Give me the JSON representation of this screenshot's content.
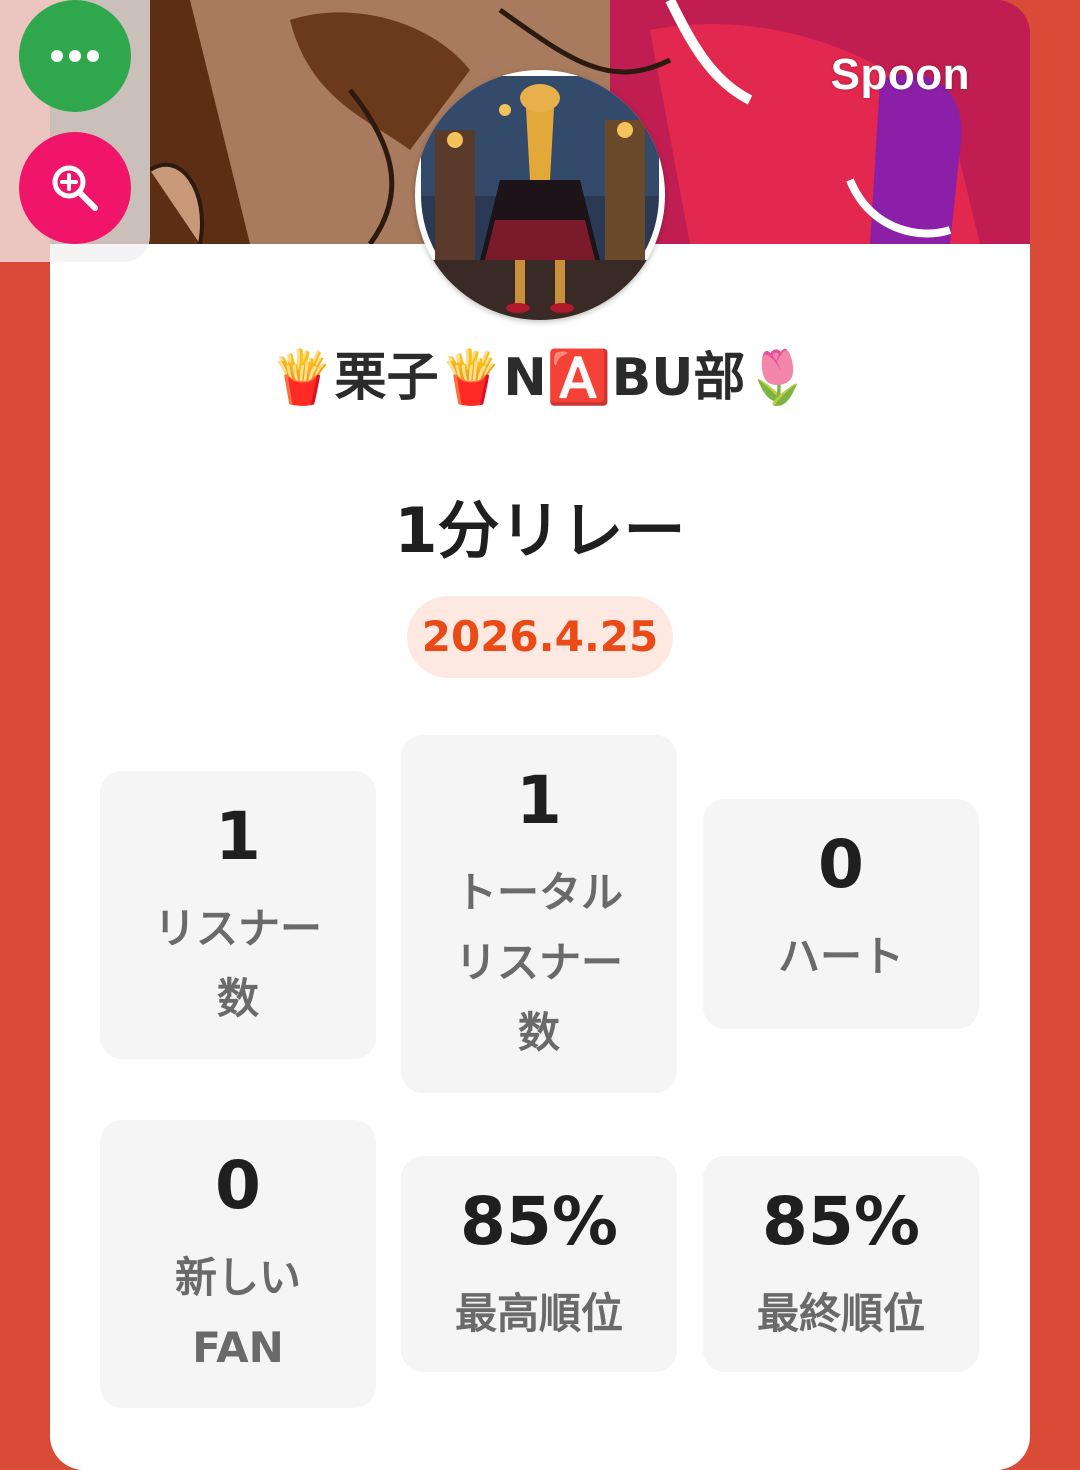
{
  "brand": "Spoon",
  "profile": {
    "name": "🍟栗子🍟N🅰️BU部🌷"
  },
  "event": {
    "title": "1分リレー",
    "date": "2026.4.25"
  },
  "stats": [
    {
      "value": "1",
      "label": "リスナー\n数"
    },
    {
      "value": "1",
      "label": "トータル\nリスナー\n数"
    },
    {
      "value": "0",
      "label": "ハート"
    },
    {
      "value": "0",
      "label": "新しい\nFAN"
    },
    {
      "value": "85%",
      "label": "最高順位"
    },
    {
      "value": "85%",
      "label": "最終順位"
    }
  ],
  "controls": {
    "more_icon": "more-horizontal-icon",
    "zoom_icon": "zoom-in-icon"
  },
  "colors": {
    "background": "#d94a37",
    "date_text": "#ea4a15",
    "date_pill": "#fde9e2",
    "more_button": "#2fa74d",
    "zoom_button": "#f0146a"
  }
}
